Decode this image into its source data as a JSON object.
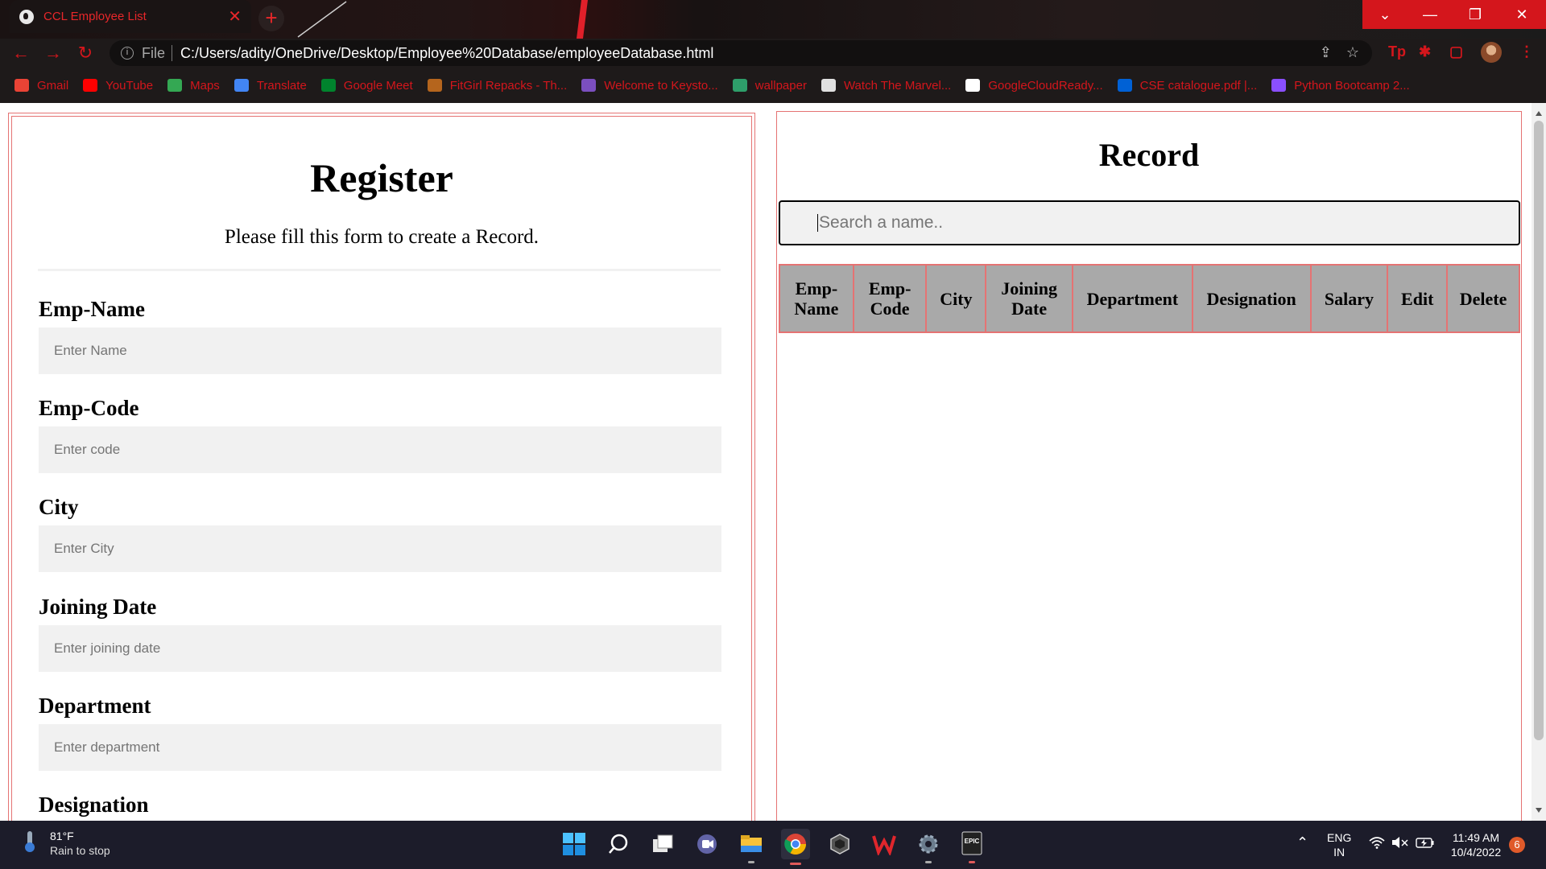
{
  "browser": {
    "tab_title": "CCL Employee List",
    "tab_close": "✕",
    "new_tab": "+",
    "window_controls": [
      "⌄",
      "—",
      "❐",
      "✕"
    ],
    "url_scheme": "File",
    "url": "C:/Users/adity/OneDrive/Desktop/Employee%20Database/employeeDatabase.html",
    "accent_color": "#d4161c"
  },
  "bookmarks": [
    {
      "label": "Gmail",
      "icon": "gmail-icon",
      "color": "#ea4335"
    },
    {
      "label": "YouTube",
      "icon": "youtube-icon",
      "color": "#ff0000"
    },
    {
      "label": "Maps",
      "icon": "maps-icon",
      "color": "#34a853"
    },
    {
      "label": "Translate",
      "icon": "translate-icon",
      "color": "#4285f4"
    },
    {
      "label": "Google Meet",
      "icon": "meet-icon",
      "color": "#00832d"
    },
    {
      "label": "FitGirl Repacks - Th...",
      "icon": "fitgirl-icon",
      "color": "#b5651d"
    },
    {
      "label": "Welcome to Keysto...",
      "icon": "upwork-icon",
      "color": "#7b4fbf"
    },
    {
      "label": "wallpaper",
      "icon": "wallpaper-icon",
      "color": "#2e9e6a"
    },
    {
      "label": "Watch The Marvel...",
      "icon": "amc-icon",
      "color": "#e0e0e0"
    },
    {
      "label": "GoogleCloudReady...",
      "icon": "google-icon",
      "color": "#ffffff"
    },
    {
      "label": "CSE catalogue.pdf |...",
      "icon": "box-icon",
      "color": "#0061d5"
    },
    {
      "label": "Python Bootcamp 2...",
      "icon": "python-bootcamp-icon",
      "color": "#8a4fff"
    }
  ],
  "register": {
    "title": "Register",
    "subtitle": "Please fill this form to create a Record.",
    "fields": [
      {
        "label": "Emp-Name",
        "placeholder": "Enter Name"
      },
      {
        "label": "Emp-Code",
        "placeholder": "Enter code"
      },
      {
        "label": "City",
        "placeholder": "Enter City"
      },
      {
        "label": "Joining Date",
        "placeholder": "Enter joining date"
      },
      {
        "label": "Department",
        "placeholder": "Enter department"
      },
      {
        "label": "Designation",
        "placeholder": ""
      }
    ]
  },
  "record": {
    "title": "Record",
    "search_placeholder": "Search a name..",
    "columns": [
      "Emp-Name",
      "Emp-Code",
      "City",
      "Joining Date",
      "Department",
      "Designation",
      "Salary",
      "Edit",
      "Delete"
    ]
  },
  "taskbar": {
    "weather_temp": "81°F",
    "weather_condition": "Rain to stop",
    "language_line1": "ENG",
    "language_line2": "IN",
    "time": "11:49 AM",
    "date": "10/4/2022",
    "notification_count": "6"
  }
}
